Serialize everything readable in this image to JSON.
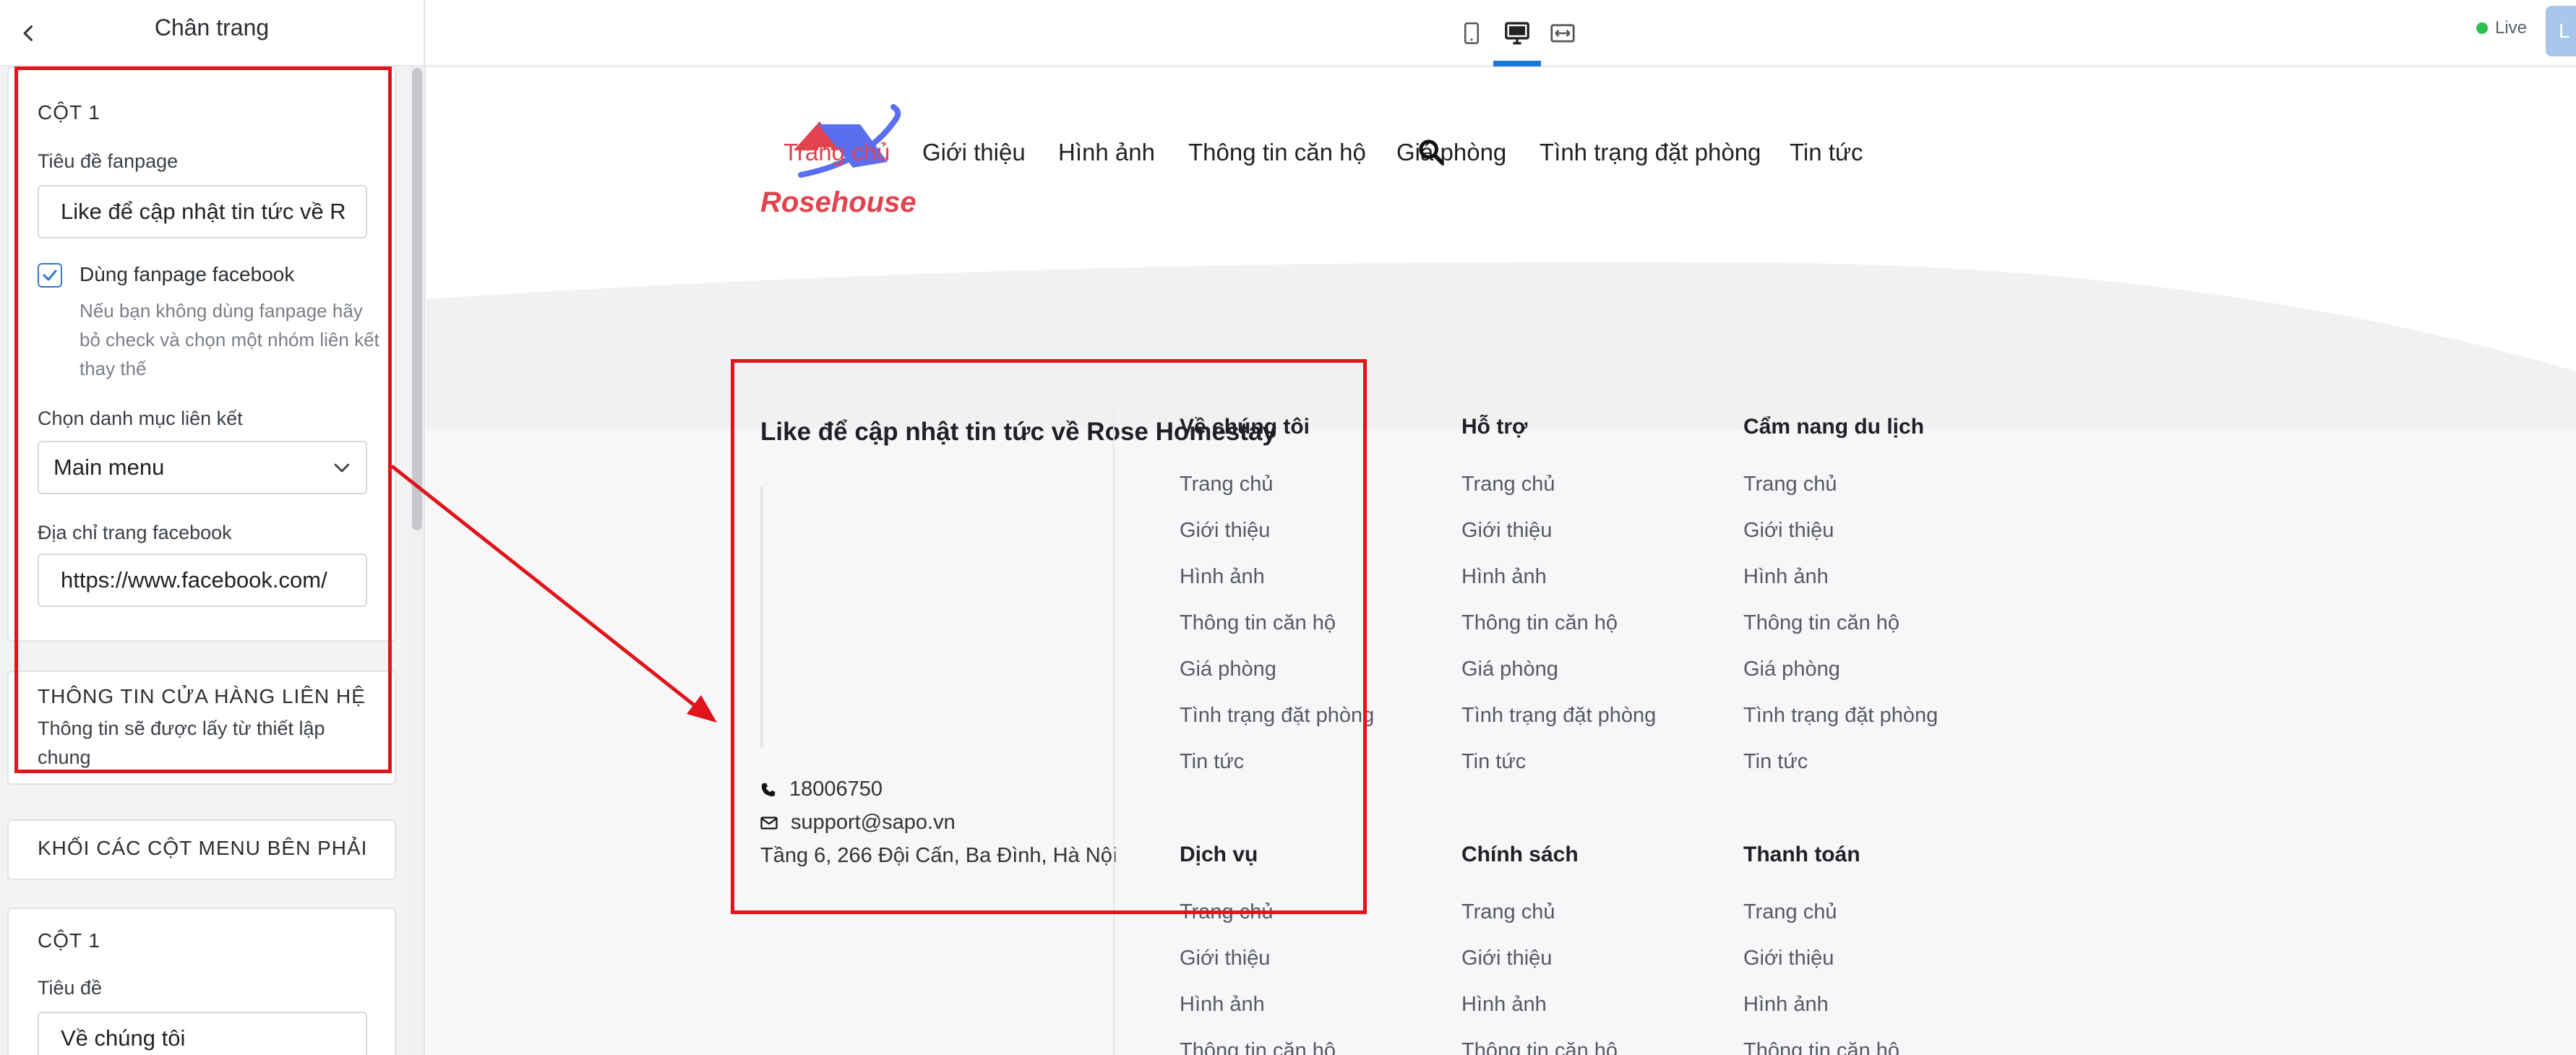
{
  "panel": {
    "title": "Chân trang",
    "card1": {
      "heading": "CỘT 1",
      "fanpage_title_label": "Tiêu đề fanpage",
      "fanpage_title_value": "Like để cập nhật tin tức về R",
      "use_fanpage_label": "Dùng fanpage facebook",
      "use_fanpage_checked": true,
      "use_fanpage_help": "Nếu bạn không dùng fanpage hãy bỏ check và chọn một nhóm liên kết thay thế",
      "link_menu_label": "Chọn danh mục liên kết",
      "link_menu_value": "Main menu",
      "facebook_url_label": "Địa chỉ trang facebook",
      "facebook_url_value": "https://www.facebook.com/"
    },
    "store_info": {
      "heading": "THÔNG TIN CỬA HÀNG LIÊN HỆ",
      "text": "Thông tin sẽ được lấy từ thiết lập chung"
    },
    "right_menu_block": {
      "heading": "KHỐI CÁC CỘT MENU BÊN PHẢI"
    },
    "card2": {
      "heading": "CỘT 1",
      "title_label": "Tiêu đề",
      "title_value": "Về chúng tôi"
    }
  },
  "topbar": {
    "live_label": "Live",
    "publish_label": "L",
    "accent_color": "#1b78d6"
  },
  "site": {
    "logo_text": "Rosehouse",
    "brand_color": "#e2434f",
    "nav": [
      {
        "label": "Trang chủ",
        "active": true
      },
      {
        "label": "Giới thiệu"
      },
      {
        "label": "Hình ảnh"
      },
      {
        "label": "Thông tin căn hộ"
      },
      {
        "label": "Giá phòng"
      },
      {
        "label": "Tình trạng đặt phòng"
      },
      {
        "label": "Tin tức"
      }
    ],
    "footer": {
      "fanpage_title": "Like để cập nhật tin tức về Rose Homestay",
      "phone": "18006750",
      "email": "support@sapo.vn",
      "address": "Tầng 6, 266 Đội Cấn, Ba Đình, Hà Nội",
      "menus": [
        {
          "title": "Về chúng tôi",
          "links": [
            "Trang chủ",
            "Giới thiệu",
            "Hình ảnh",
            "Thông tin căn hộ",
            "Giá phòng",
            "Tình trạng đặt phòng",
            "Tin tức"
          ]
        },
        {
          "title": "Hỗ trợ",
          "links": [
            "Trang chủ",
            "Giới thiệu",
            "Hình ảnh",
            "Thông tin căn hộ",
            "Giá phòng",
            "Tình trạng đặt phòng",
            "Tin tức"
          ]
        },
        {
          "title": "Cẩm nang du lịch",
          "links": [
            "Trang chủ",
            "Giới thiệu",
            "Hình ảnh",
            "Thông tin căn hộ",
            "Giá phòng",
            "Tình trạng đặt phòng",
            "Tin tức"
          ]
        },
        {
          "title": "Dịch vụ",
          "links": [
            "Trang chủ",
            "Giới thiệu",
            "Hình ảnh",
            "Thông tin căn hộ"
          ]
        },
        {
          "title": "Chính sách",
          "links": [
            "Trang chủ",
            "Giới thiệu",
            "Hình ảnh",
            "Thông tin căn hộ"
          ]
        },
        {
          "title": "Thanh toán",
          "links": [
            "Trang chủ",
            "Giới thiệu",
            "Hình ảnh",
            "Thông tin căn hộ"
          ]
        }
      ]
    }
  },
  "annotation_color": "#e0141b"
}
